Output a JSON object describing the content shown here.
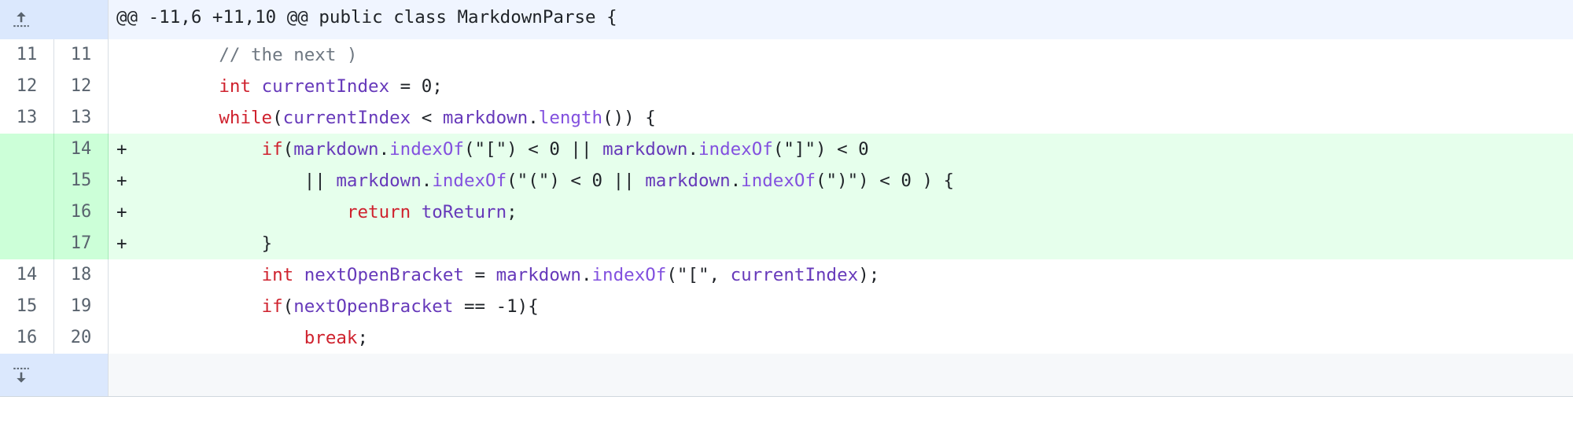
{
  "hunk": {
    "header": "@@ -11,6 +11,10 @@ public class MarkdownParse {"
  },
  "lines": [
    {
      "old": "11",
      "new": "11",
      "type": "ctx",
      "marker": "",
      "indent": "        ",
      "tokens": [
        {
          "t": "c",
          "v": "// the next )"
        }
      ]
    },
    {
      "old": "12",
      "new": "12",
      "type": "ctx",
      "marker": "",
      "indent": "        ",
      "tokens": [
        {
          "t": "k",
          "v": "int"
        },
        {
          "t": "p",
          "v": " "
        },
        {
          "t": "v",
          "v": "currentIndex"
        },
        {
          "t": "p",
          "v": " = 0;"
        }
      ]
    },
    {
      "old": "13",
      "new": "13",
      "type": "ctx",
      "marker": "",
      "indent": "        ",
      "tokens": [
        {
          "t": "k",
          "v": "while"
        },
        {
          "t": "p",
          "v": "("
        },
        {
          "t": "v",
          "v": "currentIndex"
        },
        {
          "t": "p",
          "v": " < "
        },
        {
          "t": "v",
          "v": "markdown"
        },
        {
          "t": "p",
          "v": "."
        },
        {
          "t": "f",
          "v": "length"
        },
        {
          "t": "p",
          "v": "()) {"
        }
      ]
    },
    {
      "old": "",
      "new": "14",
      "type": "add",
      "marker": "+",
      "indent": "            ",
      "tokens": [
        {
          "t": "k",
          "v": "if"
        },
        {
          "t": "p",
          "v": "("
        },
        {
          "t": "v",
          "v": "markdown"
        },
        {
          "t": "p",
          "v": "."
        },
        {
          "t": "f",
          "v": "indexOf"
        },
        {
          "t": "p",
          "v": "(\"[\") < 0 || "
        },
        {
          "t": "v",
          "v": "markdown"
        },
        {
          "t": "p",
          "v": "."
        },
        {
          "t": "f",
          "v": "indexOf"
        },
        {
          "t": "p",
          "v": "(\"]\") < 0"
        }
      ]
    },
    {
      "old": "",
      "new": "15",
      "type": "add",
      "marker": "+",
      "indent": "                ",
      "tokens": [
        {
          "t": "p",
          "v": "|| "
        },
        {
          "t": "v",
          "v": "markdown"
        },
        {
          "t": "p",
          "v": "."
        },
        {
          "t": "f",
          "v": "indexOf"
        },
        {
          "t": "p",
          "v": "(\"(\") < 0 || "
        },
        {
          "t": "v",
          "v": "markdown"
        },
        {
          "t": "p",
          "v": "."
        },
        {
          "t": "f",
          "v": "indexOf"
        },
        {
          "t": "p",
          "v": "(\")\") < 0 ) {"
        }
      ]
    },
    {
      "old": "",
      "new": "16",
      "type": "add",
      "marker": "+",
      "indent": "                    ",
      "tokens": [
        {
          "t": "k",
          "v": "return"
        },
        {
          "t": "p",
          "v": " "
        },
        {
          "t": "v",
          "v": "toReturn"
        },
        {
          "t": "p",
          "v": ";"
        }
      ]
    },
    {
      "old": "",
      "new": "17",
      "type": "add",
      "marker": "+",
      "indent": "            ",
      "tokens": [
        {
          "t": "p",
          "v": "}"
        }
      ]
    },
    {
      "old": "14",
      "new": "18",
      "type": "ctx",
      "marker": "",
      "indent": "            ",
      "tokens": [
        {
          "t": "k",
          "v": "int"
        },
        {
          "t": "p",
          "v": " "
        },
        {
          "t": "v",
          "v": "nextOpenBracket"
        },
        {
          "t": "p",
          "v": " = "
        },
        {
          "t": "v",
          "v": "markdown"
        },
        {
          "t": "p",
          "v": "."
        },
        {
          "t": "f",
          "v": "indexOf"
        },
        {
          "t": "p",
          "v": "(\"[\", "
        },
        {
          "t": "v",
          "v": "currentIndex"
        },
        {
          "t": "p",
          "v": ");"
        }
      ]
    },
    {
      "old": "15",
      "new": "19",
      "type": "ctx",
      "marker": "",
      "indent": "            ",
      "tokens": [
        {
          "t": "k",
          "v": "if"
        },
        {
          "t": "p",
          "v": "("
        },
        {
          "t": "v",
          "v": "nextOpenBracket"
        },
        {
          "t": "p",
          "v": " == -1){"
        }
      ]
    },
    {
      "old": "16",
      "new": "20",
      "type": "ctx",
      "marker": "",
      "indent": "                ",
      "tokens": [
        {
          "t": "k",
          "v": "break"
        },
        {
          "t": "p",
          "v": ";"
        }
      ]
    }
  ],
  "icons": {
    "expand_up": "expand-up-icon",
    "expand_down": "expand-down-icon"
  },
  "colors": {
    "hunk_bg": "#f0f5ff",
    "expander_bg": "#dbe8fd",
    "add_line_bg": "#e6ffec",
    "add_num_bg": "#ccffd8",
    "keyword": "#cf222e",
    "identifier": "#6639ba"
  }
}
